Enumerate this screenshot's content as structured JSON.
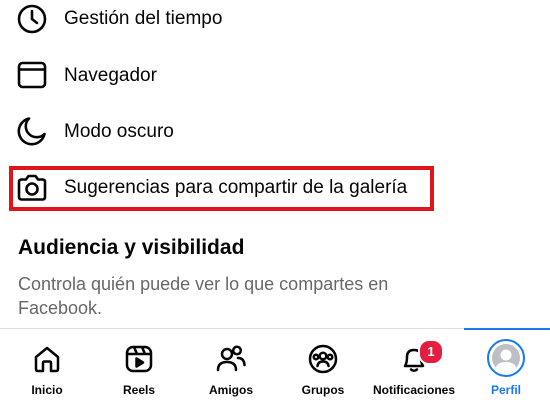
{
  "settings_items": [
    {
      "label": "Gestión del tiempo",
      "icon": "clock-icon"
    },
    {
      "label": "Navegador",
      "icon": "browser-window-icon"
    },
    {
      "label": "Modo oscuro",
      "icon": "moon-icon"
    },
    {
      "label": "Sugerencias para compartir de la galería",
      "icon": "camera-icon"
    }
  ],
  "audience_section": {
    "title": "Audiencia y visibilidad",
    "description": "Controla quién puede ver lo que compartes en Facebook."
  },
  "tab_bar": {
    "active_tab": "Perfil",
    "accent_color": "#1877f2",
    "tabs": [
      {
        "label": "Inicio",
        "icon": "home-icon"
      },
      {
        "label": "Reels",
        "icon": "reels-icon"
      },
      {
        "label": "Amigos",
        "icon": "friends-icon"
      },
      {
        "label": "Grupos",
        "icon": "groups-icon"
      },
      {
        "label": "Notificaciones",
        "icon": "bell-icon",
        "badge": "1"
      },
      {
        "label": "Perfil",
        "icon": "avatar-icon"
      }
    ]
  },
  "highlight_color": "#e0151b",
  "badge_color": "#e41e3f"
}
